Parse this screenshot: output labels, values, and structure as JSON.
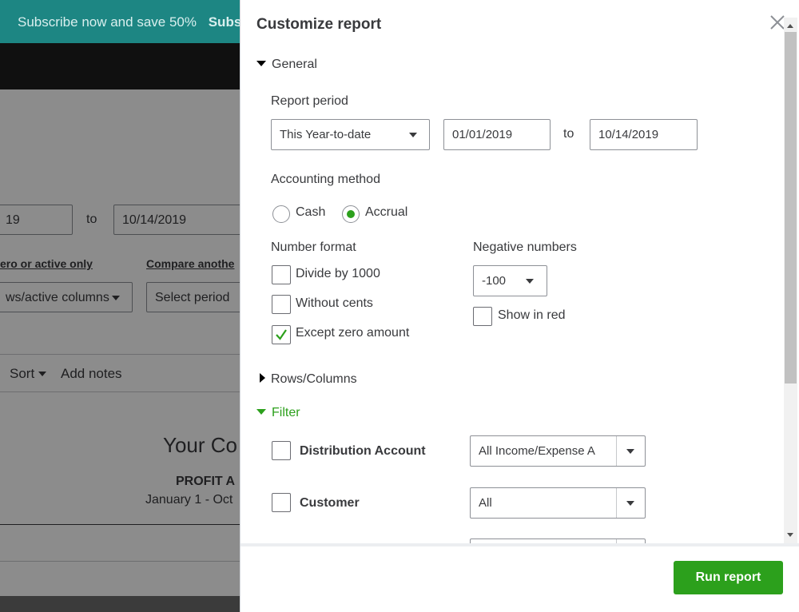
{
  "banner": {
    "text": "Subscribe now and save 50%",
    "cta": "Subs"
  },
  "background": {
    "from_date": "19",
    "to_label": "to",
    "to_date": "10/14/2019",
    "rows_link": "ero or active only",
    "compare_link": "Compare anothe",
    "rows_select": "ws/active columns",
    "period_select": "Select period",
    "sort": "Sort",
    "add_notes": "Add notes",
    "company_title": "Your Co",
    "report_name": "PROFIT A",
    "report_range": "January 1 - Oct"
  },
  "drawer": {
    "title": "Customize report",
    "general": {
      "heading": "General",
      "report_period_label": "Report period",
      "period_select": "This Year-to-date",
      "from_date": "01/01/2019",
      "to_label": "to",
      "to_date": "10/14/2019",
      "accounting_method_label": "Accounting method",
      "cash_label": "Cash",
      "accrual_label": "Accrual",
      "number_format_label": "Number format",
      "divide_label": "Divide by 1000",
      "cents_label": "Without cents",
      "zero_label": "Except zero amount",
      "negative_label": "Negative numbers",
      "negative_select": "-100",
      "red_label": "Show in red"
    },
    "rows_columns": {
      "heading": "Rows/Columns"
    },
    "filter": {
      "heading": "Filter",
      "distribution_label": "Distribution Account",
      "distribution_select": "All Income/Expense A",
      "customer_label": "Customer",
      "customer_select": "All"
    },
    "run_button": "Run report"
  },
  "colors": {
    "accent_green": "#2ca01c",
    "banner": "#1d8683"
  }
}
